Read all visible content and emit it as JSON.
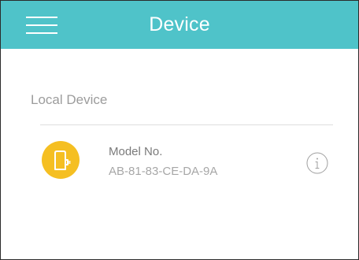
{
  "header": {
    "title": "Device",
    "menu_icon": "hamburger-menu-icon"
  },
  "colors": {
    "header_background": "#4fc3c9",
    "device_icon_background": "#f5bf22",
    "section_text": "#9c9c9c",
    "divider": "#dedede"
  },
  "local_devices": {
    "title": "Local Device",
    "items": [
      {
        "icon": "smart-plug-icon",
        "model_label": "Model No.",
        "model_value": "AB-81-83-CE-DA-9A",
        "info_icon": "info-icon"
      }
    ]
  }
}
